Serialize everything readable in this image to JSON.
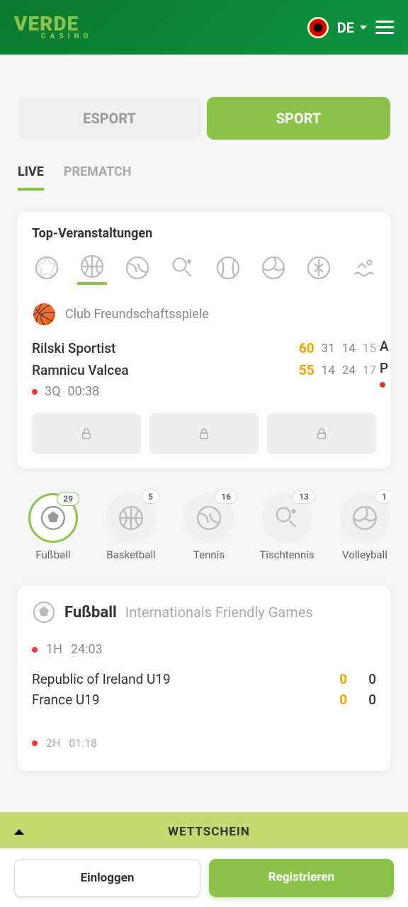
{
  "header": {
    "logo_main": "VERDE",
    "logo_sub": "CASINO",
    "lang": "DE"
  },
  "main_tabs": {
    "esport": "ESPORT",
    "sport": "SPORT"
  },
  "sub_tabs": {
    "live": "LIVE",
    "prematch": "PREMATCH"
  },
  "top_events": {
    "title": "Top-Veranstaltungen",
    "league": "Club Freundschaftsspiele",
    "team1": "Rilski Sportist",
    "team2": "Ramnicu Valcea",
    "score1": "60",
    "score2": "55",
    "q1a": "31",
    "q1b": "14",
    "q1c": "15",
    "q2a": "14",
    "q2b": "24",
    "q2c": "17",
    "period": "3Q",
    "time": "00:38",
    "peek1": "A",
    "peek2": "P"
  },
  "sport_categories": [
    {
      "label": "Fußball",
      "count": "29",
      "active": true
    },
    {
      "label": "Basketball",
      "count": "5",
      "active": false
    },
    {
      "label": "Tennis",
      "count": "16",
      "active": false
    },
    {
      "label": "Tischtennis",
      "count": "13",
      "active": false
    },
    {
      "label": "Volleyball",
      "count": "1",
      "active": false
    }
  ],
  "football_section": {
    "sport": "Fußball",
    "league": "Internationals Friendly Games",
    "period": "1H",
    "time": "24:03",
    "team1": "Republic of Ireland U19",
    "team2": "France U19",
    "s1a": "0",
    "s1b": "0",
    "s2a": "0",
    "s2b": "0",
    "hidden_period": "2H",
    "hidden_time": "01:18"
  },
  "betslip": "WETTSCHEIN",
  "buttons": {
    "login": "Einloggen",
    "register": "Registrieren"
  }
}
